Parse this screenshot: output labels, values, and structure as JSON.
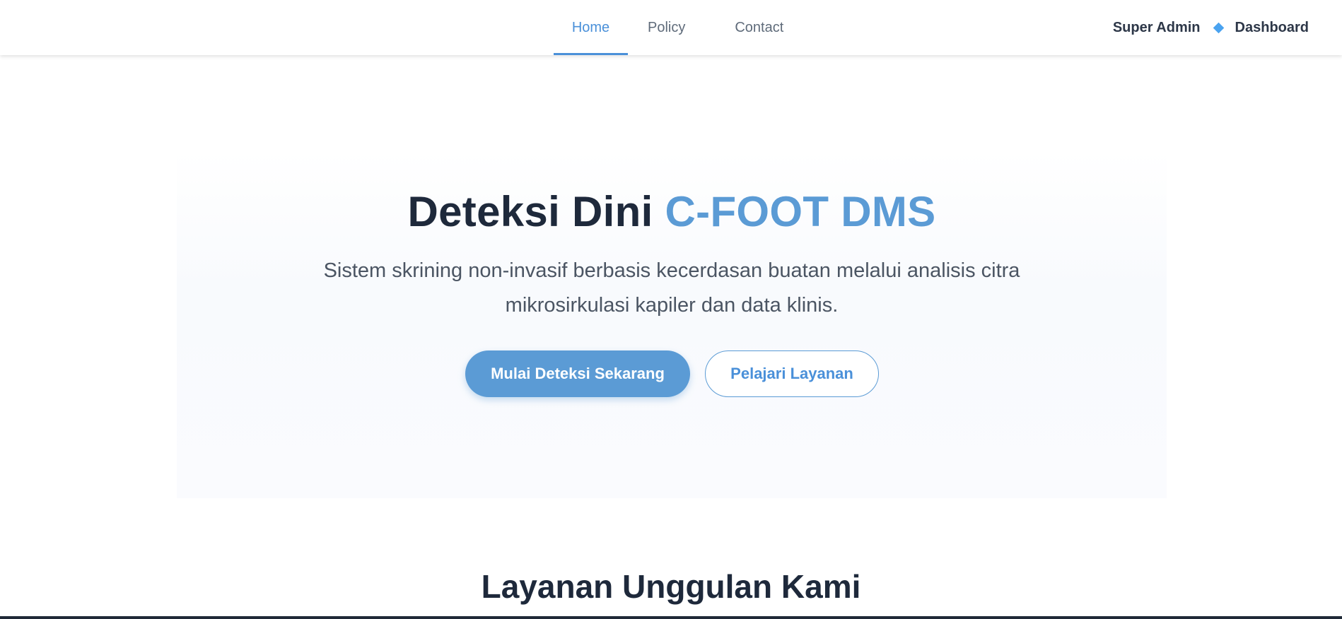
{
  "nav": {
    "links": [
      "Home",
      "Policy",
      "Contact"
    ],
    "active": "Home",
    "user_name": "Super Admin",
    "dashboard_label": "Dashboard"
  },
  "hero": {
    "title_main": "Deteksi Dini ",
    "title_accent": "C-FOOT DMS",
    "subtitle": "Sistem skrining non-invasif berbasis kecerdasan buatan melalui analisis citra mikrosirkulasi kapiler dan data klinis.",
    "primary_button": "Mulai Deteksi Sekarang",
    "secondary_button": "Pelajari Layanan"
  },
  "services": {
    "title": "Layanan Unggulan Kami"
  },
  "colors": {
    "accent": "#5b9bd5",
    "active_nav": "#4a90d9",
    "heading": "#1e293b"
  }
}
